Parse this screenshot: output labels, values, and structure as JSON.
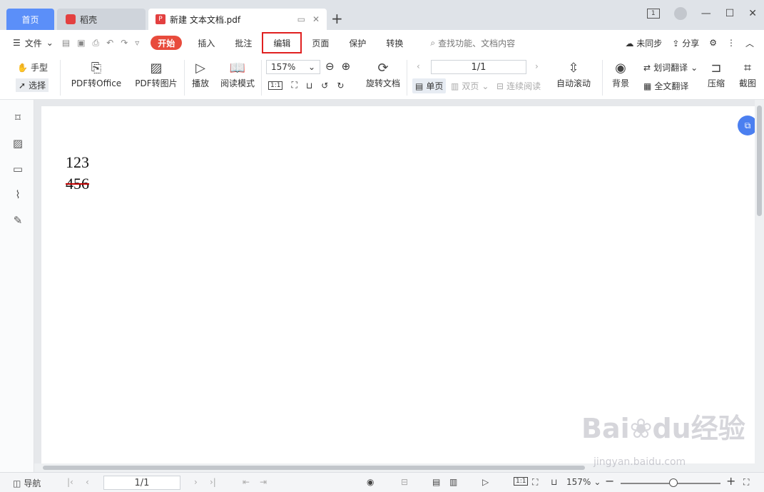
{
  "tabs": {
    "home": "首页",
    "daoke": "稻壳",
    "doc": "新建 文本文档.pdf",
    "add": "+"
  },
  "window": {
    "badge": "1"
  },
  "menu": {
    "file": "文件",
    "start": "开始",
    "items": [
      "插入",
      "批注",
      "编辑",
      "页面",
      "保护",
      "转换"
    ],
    "search": "查找功能、文档内容",
    "sync": "未同步",
    "share": "分享"
  },
  "toolbar": {
    "hand": "手型",
    "select": "选择",
    "pdf_to_office": "PDF转Office",
    "pdf_to_image": "PDF转图片",
    "play": "播放",
    "read_mode": "阅读模式",
    "zoom": "157%",
    "actual": "1:1",
    "rotate_doc": "旋转文档",
    "page": "1/1",
    "single": "单页",
    "double": "双页",
    "continuous": "连续阅读",
    "auto_scroll": "自动滚动",
    "background": "背景",
    "word_translate": "划词翻译",
    "full_translate": "全文翻译",
    "compress": "压缩",
    "screenshot": "截图"
  },
  "document": {
    "line1": "123",
    "line2": "456"
  },
  "status": {
    "nav": "导航",
    "page": "1/1",
    "actual": "1:1",
    "zoom": "157%"
  },
  "watermark": {
    "brand": "Bai",
    "brand2": "du",
    "cn": "经验",
    "url": "jingyan.baidu.com"
  }
}
